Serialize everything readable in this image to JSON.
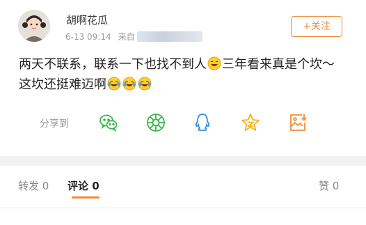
{
  "user": {
    "name": "胡啊花瓜",
    "date": "6-13 09:14",
    "from_label": "来自"
  },
  "follow_button": {
    "label": "+关注"
  },
  "post": {
    "text_part1": "两天不联系，联系一下也找不到人",
    "text_part2": "三年看来真是个坎～这坎还挺难迈啊"
  },
  "share": {
    "label": "分享到",
    "targets": [
      "wechat-icon",
      "moments-icon",
      "qq-icon",
      "qzone-icon",
      "save-image-icon"
    ]
  },
  "tabs": {
    "repost": "转发 0",
    "comment": "评论 0",
    "like": "赞 0"
  },
  "colors": {
    "accent": "#f38b3a",
    "share_green": "#3cb54a",
    "share_blue": "#2f8fe0",
    "share_yellow": "#f5b21b"
  }
}
